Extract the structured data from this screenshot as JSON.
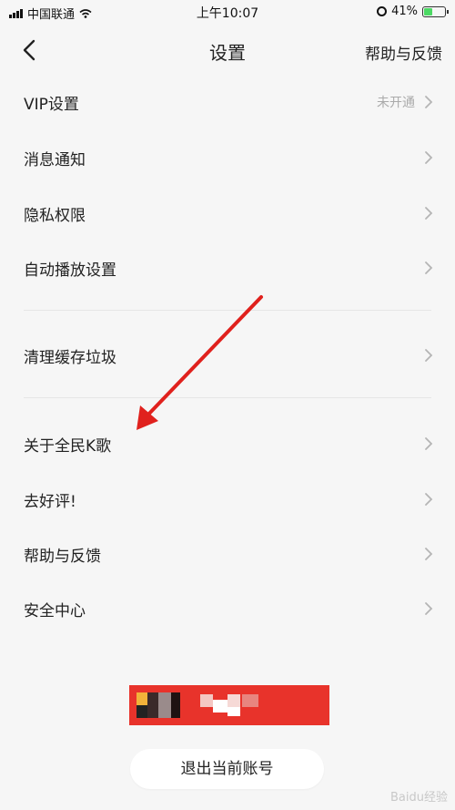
{
  "status_bar": {
    "carrier": "中国联通",
    "time": "上午10:07",
    "battery_percent": "41%",
    "battery_level": 0.41
  },
  "nav": {
    "title": "设置",
    "help_label": "帮助与反馈"
  },
  "settings": [
    {
      "label": "VIP设置",
      "value": "未开通"
    },
    {
      "label": "消息通知",
      "value": ""
    },
    {
      "label": "隐私权限",
      "value": ""
    },
    {
      "label": "自动播放设置",
      "value": ""
    },
    {
      "label": "清理缓存垃圾",
      "value": ""
    },
    {
      "label": "关于全民K歌",
      "value": ""
    },
    {
      "label": "去好评!",
      "value": ""
    },
    {
      "label": "帮助与反馈",
      "value": ""
    },
    {
      "label": "安全中心",
      "value": ""
    }
  ],
  "logout_label": "退出当前账号",
  "watermark": "Baidu经验",
  "colors": {
    "accent_red": "#e8332b",
    "page_bg": "#f6f6f6",
    "battery_green": "#4cd964"
  }
}
